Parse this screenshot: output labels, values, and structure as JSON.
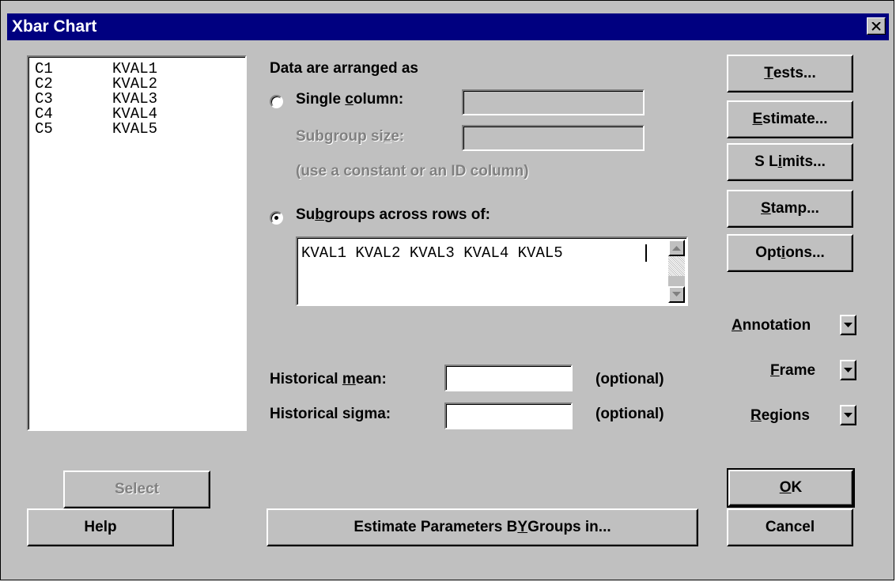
{
  "window": {
    "title": "Xbar Chart"
  },
  "columns": [
    {
      "id": "C1",
      "name": "KVAL1"
    },
    {
      "id": "C2",
      "name": "KVAL2"
    },
    {
      "id": "C3",
      "name": "KVAL3"
    },
    {
      "id": "C4",
      "name": "KVAL4"
    },
    {
      "id": "C5",
      "name": "KVAL5"
    }
  ],
  "arrangement": {
    "heading": "Data are arranged as",
    "single_column": {
      "label_pre": "Single ",
      "label_u": "c",
      "label_post": "olumn:",
      "value": "",
      "selected": false
    },
    "subgroup_size": {
      "label_pre": "Subgroup si",
      "label_u": "z",
      "label_post": "e:",
      "value": ""
    },
    "hint": "(use a constant or an ID column)",
    "subgroups_rows": {
      "label_pre": "Su",
      "label_u": "b",
      "label_post": "groups across rows of:",
      "selected": true,
      "value": "KVAL1 KVAL2 KVAL3 KVAL4 KVAL5"
    }
  },
  "historical": {
    "mean": {
      "label_pre": "Historical ",
      "label_u": "m",
      "label_post": "ean:",
      "value": "",
      "note": "(optional)"
    },
    "sigma": {
      "label": "Historical sigma:",
      "value": "",
      "note": "(optional)"
    }
  },
  "buttons": {
    "tests": {
      "u": "T",
      "rest": "ests..."
    },
    "estimate": {
      "u": "E",
      "rest": "stimate..."
    },
    "slimits": {
      "pre": "S L",
      "u": "i",
      "rest": "mits..."
    },
    "stamp": {
      "u": "S",
      "rest": "tamp..."
    },
    "options": {
      "pre": "Opt",
      "u": "i",
      "rest": "ons..."
    },
    "select": "Select",
    "help": "Help",
    "by_groups": {
      "pre": "Estimate Parameters B",
      "u": "Y",
      "rest": " Groups in..."
    },
    "ok": {
      "u": "O",
      "rest": "K"
    },
    "cancel": "Cancel"
  },
  "dropdowns": {
    "annotation": {
      "u": "A",
      "rest": "nnotation"
    },
    "frame": {
      "u": "F",
      "rest": "rame"
    },
    "regions": {
      "u": "R",
      "rest": "egions"
    }
  }
}
